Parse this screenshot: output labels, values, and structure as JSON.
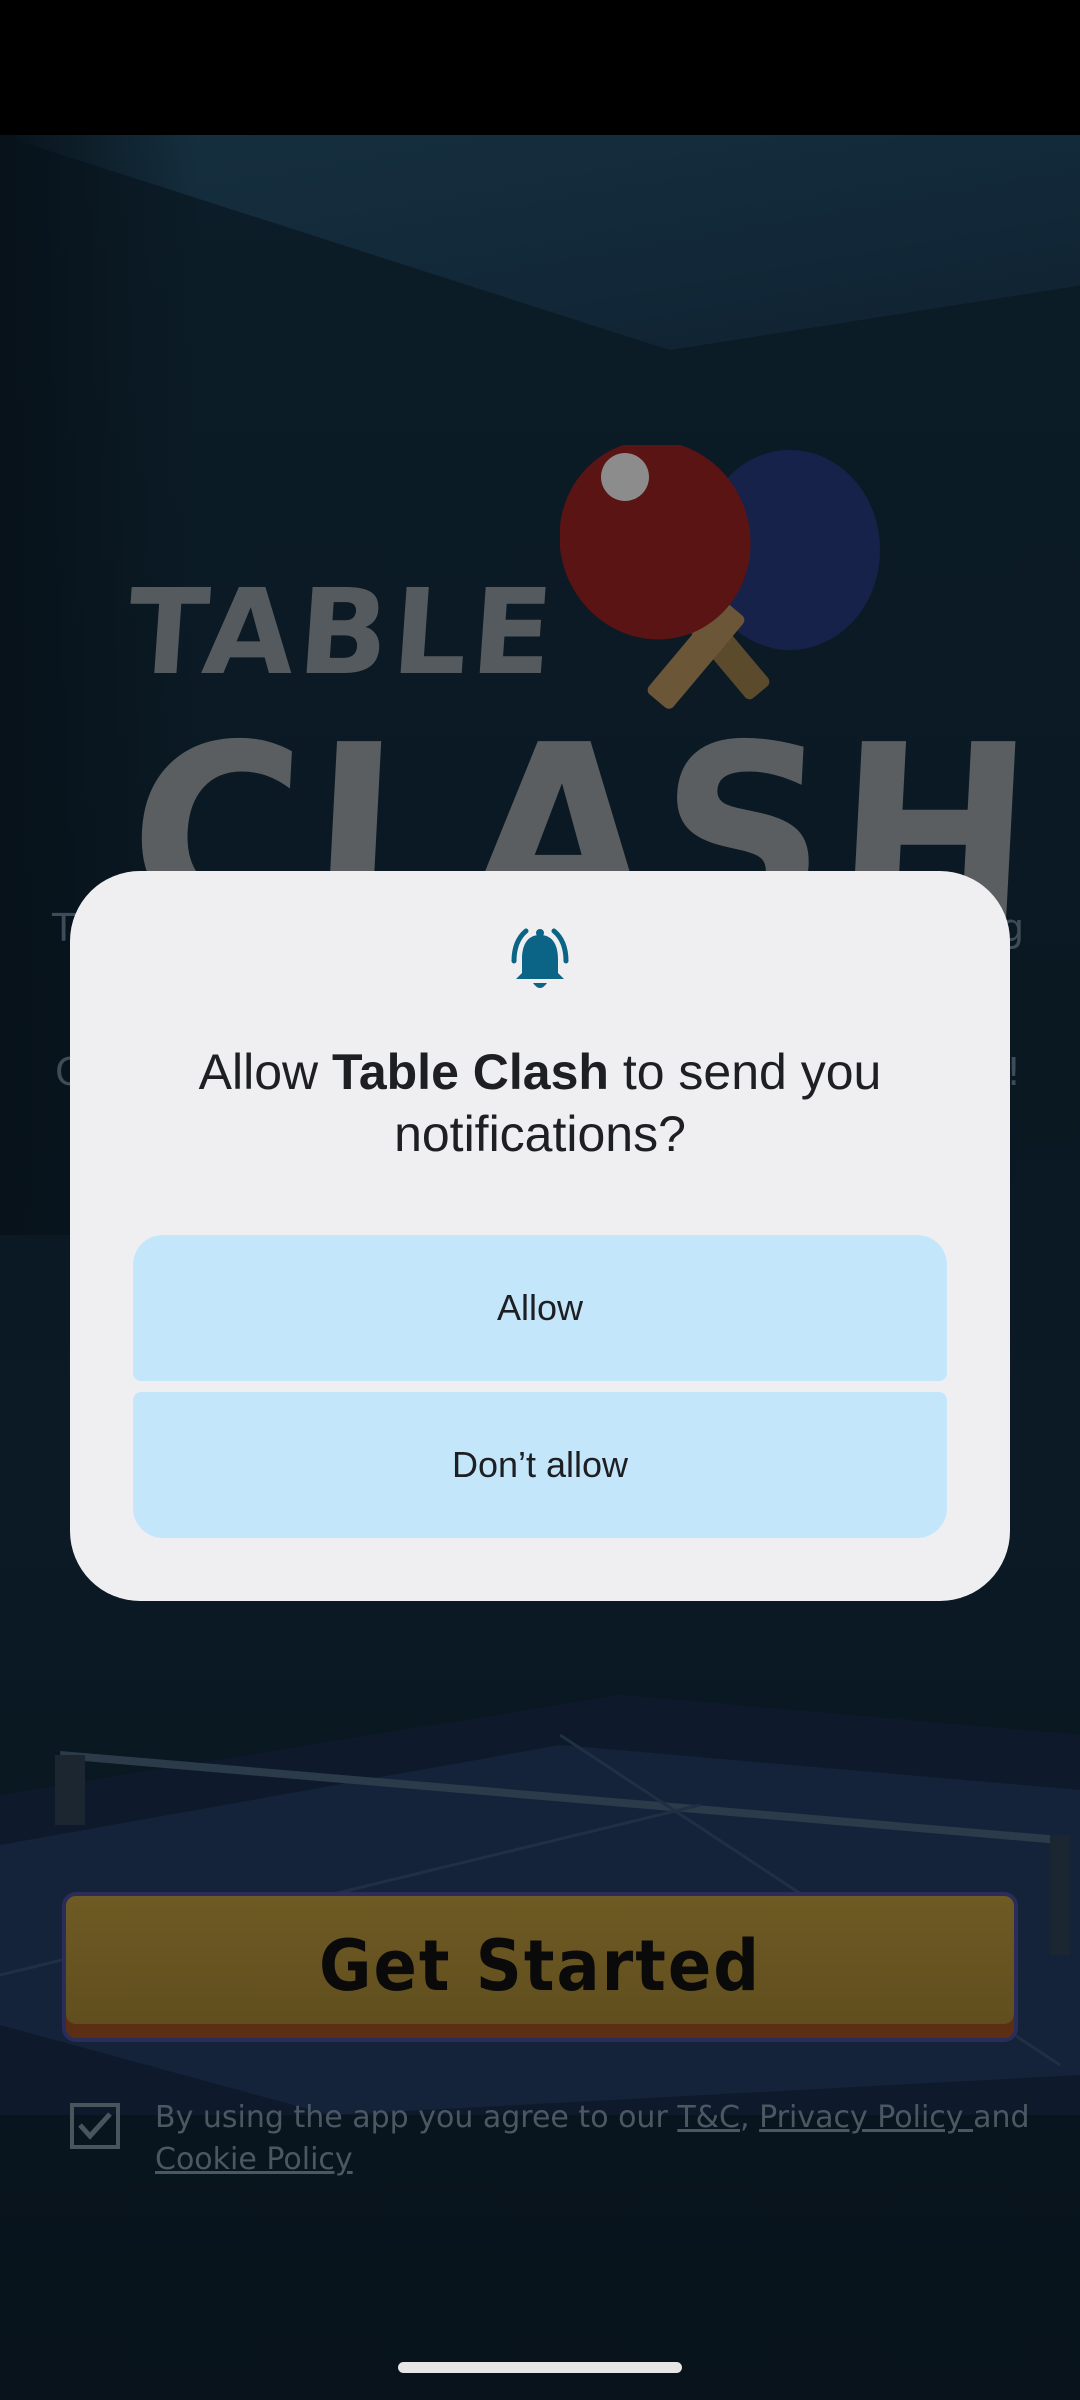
{
  "app": {
    "logo_line1": "TABLE",
    "logo_line2": "CLASH",
    "bg_text_1_left": "T",
    "bg_text_1_right": "g",
    "bg_text_2_left": "C",
    "bg_text_2_right": "!",
    "get_started_label": "Get Started",
    "terms": {
      "prefix": "By using the app you agree to our ",
      "tc_link": "T&C",
      "sep": ", ",
      "privacy_link": "Privacy Policy ",
      "and": "and ",
      "cookie_link": "Cookie Policy"
    }
  },
  "dialog": {
    "title_prefix": "Allow ",
    "title_app": "Table Clash",
    "title_suffix": " to send you notifications?",
    "allow_label": "Allow",
    "deny_label": "Don’t allow",
    "icon": "bell-ringing-icon",
    "accent_color": "#0b6486"
  }
}
